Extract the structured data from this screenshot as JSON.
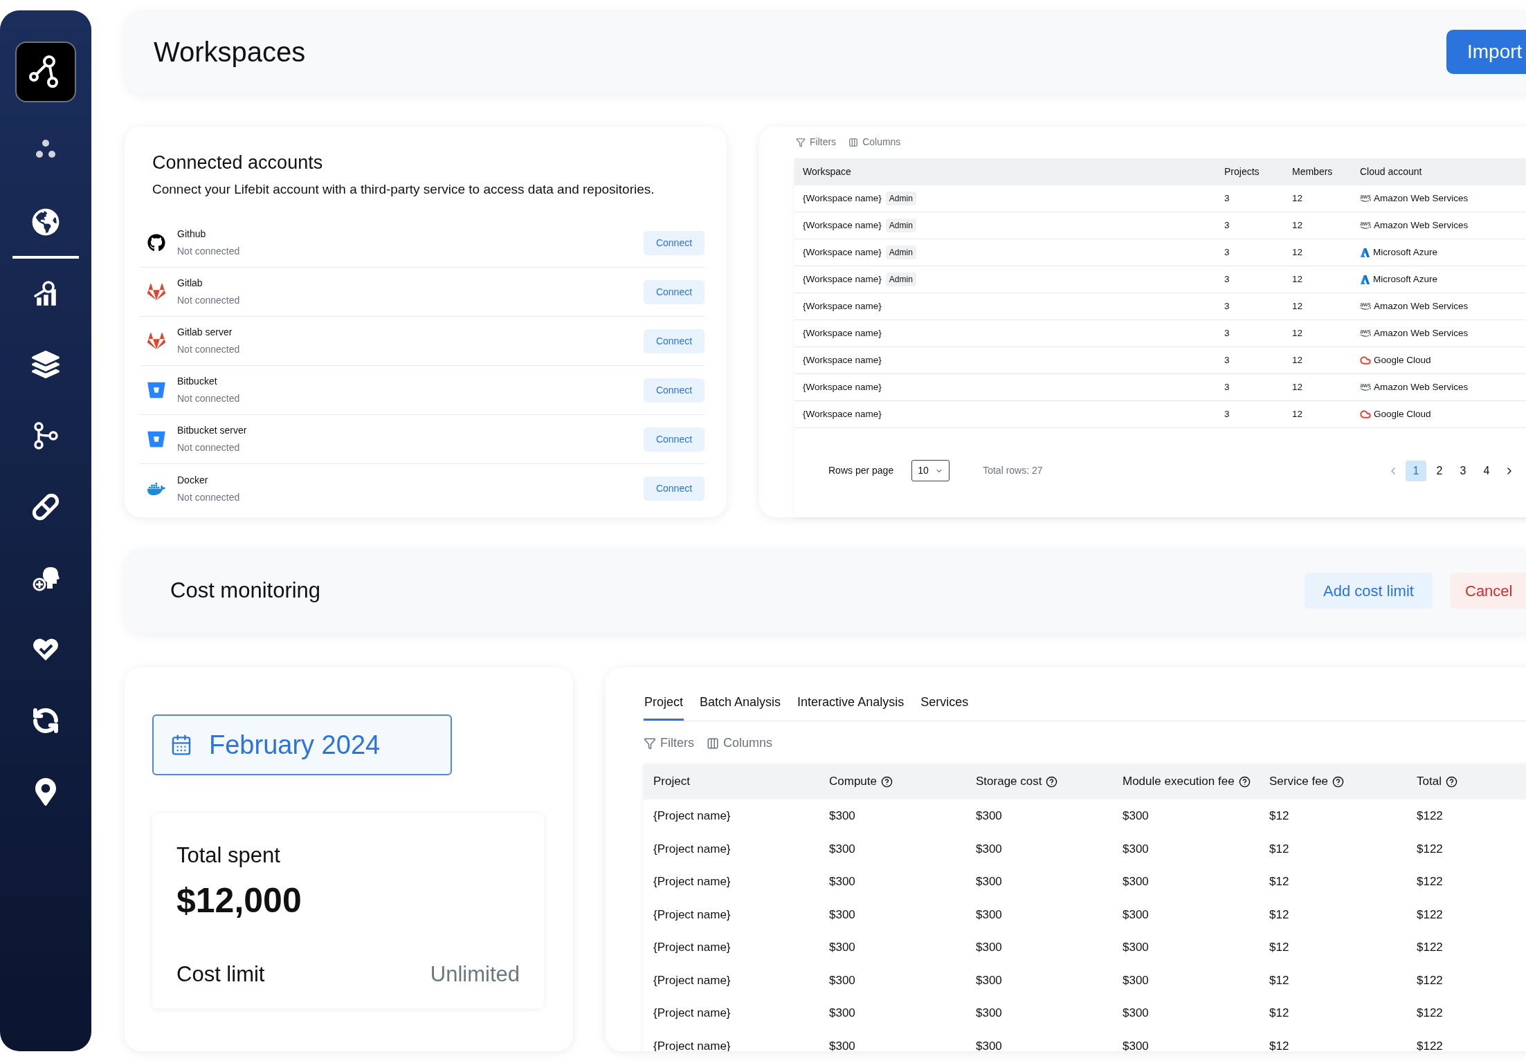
{
  "sidebar": {
    "items": [
      {
        "kind": "dots",
        "selected": false
      },
      {
        "kind": "globe",
        "selected": true
      },
      {
        "kind": "analytics",
        "selected": false
      },
      {
        "kind": "layers",
        "selected": false
      },
      {
        "kind": "branches",
        "selected": false
      },
      {
        "kind": "pill",
        "selected": false
      },
      {
        "kind": "head",
        "selected": false
      },
      {
        "kind": "heart",
        "selected": false
      },
      {
        "kind": "sync",
        "selected": false
      },
      {
        "kind": "pin",
        "selected": false
      }
    ]
  },
  "header": {
    "title": "Workspaces",
    "button": "Import"
  },
  "connected_accounts": {
    "title": "Connected accounts",
    "subtitle": "Connect your Lifebit account with a third-party service to access data and repositories.",
    "accounts": [
      {
        "kind": "github",
        "name": "Github",
        "status": "Not connected",
        "button": "Connect"
      },
      {
        "kind": "gitlab",
        "name": "Gitlab",
        "status": "Not connected",
        "button": "Connect"
      },
      {
        "kind": "gitlab",
        "name": "Gitlab server",
        "status": "Not connected",
        "button": "Connect"
      },
      {
        "kind": "bitbucket",
        "name": "Bitbucket",
        "status": "Not connected",
        "button": "Connect"
      },
      {
        "kind": "bitbucket",
        "name": "Bitbucket server",
        "status": "Not connected",
        "button": "Connect"
      },
      {
        "kind": "docker",
        "name": "Docker",
        "status": "Not connected",
        "button": "Connect"
      }
    ]
  },
  "workspaces_table": {
    "toolbar": [
      "Filters",
      "Columns"
    ],
    "columns": [
      "Workspace",
      "Projects",
      "Members",
      "Cloud account"
    ],
    "rows": [
      {
        "workspace": "{Workspace name}",
        "badge": "Admin",
        "projects": "3",
        "members": "12",
        "kind": "aws",
        "cloud": "Amazon Web Services"
      },
      {
        "workspace": "{Workspace name}",
        "badge": "Admin",
        "projects": "3",
        "members": "12",
        "kind": "aws",
        "cloud": "Amazon Web Services"
      },
      {
        "workspace": "{Workspace name}",
        "badge": "Admin",
        "projects": "3",
        "members": "12",
        "kind": "azure",
        "cloud": "Microsoft Azure"
      },
      {
        "workspace": "{Workspace name}",
        "badge": "Admin",
        "projects": "3",
        "members": "12",
        "kind": "azure",
        "cloud": "Microsoft Azure"
      },
      {
        "workspace": "{Workspace name}",
        "projects": "3",
        "members": "12",
        "kind": "aws",
        "cloud": "Amazon Web Services"
      },
      {
        "workspace": "{Workspace name}",
        "projects": "3",
        "members": "12",
        "kind": "aws",
        "cloud": "Amazon Web Services"
      },
      {
        "workspace": "{Workspace name}",
        "projects": "3",
        "members": "12",
        "kind": "gcp",
        "cloud": "Google Cloud"
      },
      {
        "workspace": "{Workspace name}",
        "projects": "3",
        "members": "12",
        "kind": "aws",
        "cloud": "Amazon Web Services"
      },
      {
        "workspace": "{Workspace name}",
        "projects": "3",
        "members": "12",
        "kind": "gcp",
        "cloud": "Google Cloud"
      }
    ],
    "pagination": {
      "rows_per_page_label": "Rows per page",
      "rows_per_page": "10",
      "total": "Total rows: 27",
      "pages": [
        {
          "label": "1",
          "selected": true
        },
        {
          "label": "2",
          "selected": false
        },
        {
          "label": "3",
          "selected": false
        },
        {
          "label": "4",
          "selected": false
        }
      ]
    }
  },
  "cost_monitoring": {
    "title": "Cost monitoring",
    "buttons": [
      {
        "kind": "primary",
        "label": "Add cost limit"
      },
      {
        "kind": "danger",
        "label": "Cancel"
      }
    ]
  },
  "period": {
    "label": "February 2024"
  },
  "summary": {
    "total_label": "Total spent",
    "total_value": "$12,000",
    "limit_label": "Cost limit",
    "limit_value": "Unlimited"
  },
  "costs": {
    "tabs": [
      {
        "label": "Project",
        "selected": true
      },
      {
        "label": "Batch Analysis",
        "selected": false
      },
      {
        "label": "Interactive Analysis",
        "selected": false
      },
      {
        "label": "Services",
        "selected": false
      }
    ],
    "toolbar": [
      "Filters",
      "Columns"
    ],
    "columns": [
      {
        "label": "Project",
        "help": false
      },
      {
        "label": "Compute",
        "help": true
      },
      {
        "label": "Storage cost",
        "help": true
      },
      {
        "label": "Module execution fee",
        "help": true
      },
      {
        "label": "Service fee",
        "help": true
      },
      {
        "label": "Total",
        "help": true
      }
    ],
    "rows": [
      [
        "{Project name}",
        "$300",
        "$300",
        "$300",
        "$12",
        "$122"
      ],
      [
        "{Project name}",
        "$300",
        "$300",
        "$300",
        "$12",
        "$122"
      ],
      [
        "{Project name}",
        "$300",
        "$300",
        "$300",
        "$12",
        "$122"
      ],
      [
        "{Project name}",
        "$300",
        "$300",
        "$300",
        "$12",
        "$122"
      ],
      [
        "{Project name}",
        "$300",
        "$300",
        "$300",
        "$12",
        "$122"
      ],
      [
        "{Project name}",
        "$300",
        "$300",
        "$300",
        "$12",
        "$122"
      ],
      [
        "{Project name}",
        "$300",
        "$300",
        "$300",
        "$12",
        "$122"
      ],
      [
        "{Project name}",
        "$300",
        "$300",
        "$300",
        "$12",
        "$122"
      ]
    ]
  }
}
